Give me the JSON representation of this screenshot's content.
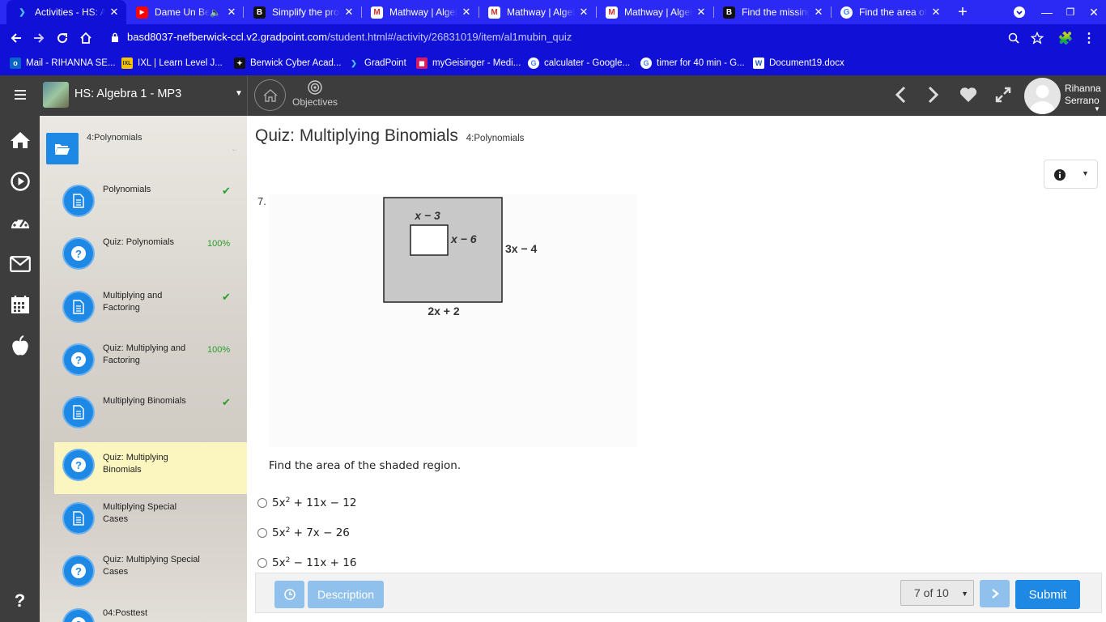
{
  "browser": {
    "tabs": [
      {
        "title": "Activities - HS: Algebra",
        "favicon": "gradpoint-icon",
        "active": true
      },
      {
        "title": "Dame Un Beso",
        "favicon": "youtube-icon",
        "active": false
      },
      {
        "title": "Simplify the product",
        "favicon": "brainly-icon",
        "active": false
      },
      {
        "title": "Mathway | Algebra",
        "favicon": "mathway-icon",
        "active": false
      },
      {
        "title": "Mathway | Algebra",
        "favicon": "mathway-icon",
        "active": false
      },
      {
        "title": "Mathway | Algebra",
        "favicon": "mathway-icon",
        "active": false
      },
      {
        "title": "Find the missing",
        "favicon": "brainly-icon",
        "active": false
      },
      {
        "title": "Find the area of the",
        "favicon": "google-icon",
        "active": false
      }
    ],
    "url_host": "basd8037-nefberwick-ccl.v2.gradpoint.com",
    "url_path": "/student.html#/activity/26831019/item/al1mubin_quiz",
    "bookmarks": [
      {
        "label": "Mail - RIHANNA SE...",
        "icon": "outlook-icon"
      },
      {
        "label": "IXL | Learn Level J...",
        "icon": "ixl-icon"
      },
      {
        "label": "Berwick Cyber Acad...",
        "icon": "berwick-icon"
      },
      {
        "label": "GradPoint",
        "icon": "gradpoint-icon"
      },
      {
        "label": "myGeisinger - Medi...",
        "icon": "geisinger-icon"
      },
      {
        "label": "calculater - Google...",
        "icon": "google-icon"
      },
      {
        "label": "timer for 40 min - G...",
        "icon": "google-icon"
      },
      {
        "label": "Document19.docx",
        "icon": "word-icon"
      }
    ]
  },
  "header": {
    "course_title": "HS: Algebra 1 - MP3",
    "objectives_label": "Objectives",
    "user_first": "Rihanna",
    "user_last": "Serrano"
  },
  "sidebar": {
    "unit": "4:Polynomials",
    "items": [
      {
        "label": "Polynomials",
        "type": "lesson",
        "status": "check"
      },
      {
        "label": "Quiz: Polynomials",
        "type": "quiz",
        "status": "100%"
      },
      {
        "label": "Multiplying and Factoring",
        "type": "lesson",
        "status": "check"
      },
      {
        "label": "Quiz: Multiplying and Factoring",
        "type": "quiz",
        "status": "100%"
      },
      {
        "label": "Multiplying Binomials",
        "type": "lesson",
        "status": "check"
      },
      {
        "label": "Quiz: Multiplying Binomials",
        "type": "quiz",
        "status": "current"
      },
      {
        "label": "Multiplying Special Cases",
        "type": "lesson",
        "status": ""
      },
      {
        "label": "Quiz: Multiplying Special Cases",
        "type": "quiz",
        "status": ""
      },
      {
        "label": "04:Posttest",
        "type": "quiz",
        "status": ""
      }
    ]
  },
  "main": {
    "title": "Quiz: Multiplying Binomials",
    "subtitle": "4:Polynomials",
    "question_number": "7.",
    "figure": {
      "inner_top_label": "x − 3",
      "inner_side_label": "x − 6",
      "outer_side_label": "3x − 4",
      "outer_bottom_label": "2x + 2"
    },
    "prompt": "Find the area of the shaded region.",
    "choices": [
      {
        "a": "5x",
        "exp": "2",
        "rest": " + 11x − 12"
      },
      {
        "a": "5x",
        "exp": "2",
        "rest": " + 7x − 26"
      },
      {
        "a": "5x",
        "exp": "2",
        "rest": " − 11x + 16"
      }
    ]
  },
  "footer": {
    "description_label": "Description",
    "pager_value": "7 of 10",
    "submit_label": "Submit"
  },
  "colors": {
    "chrome": "#1010d6",
    "accent": "#1e88e5",
    "success": "#2a9d2a",
    "current_highlight": "#fbf5c0"
  }
}
